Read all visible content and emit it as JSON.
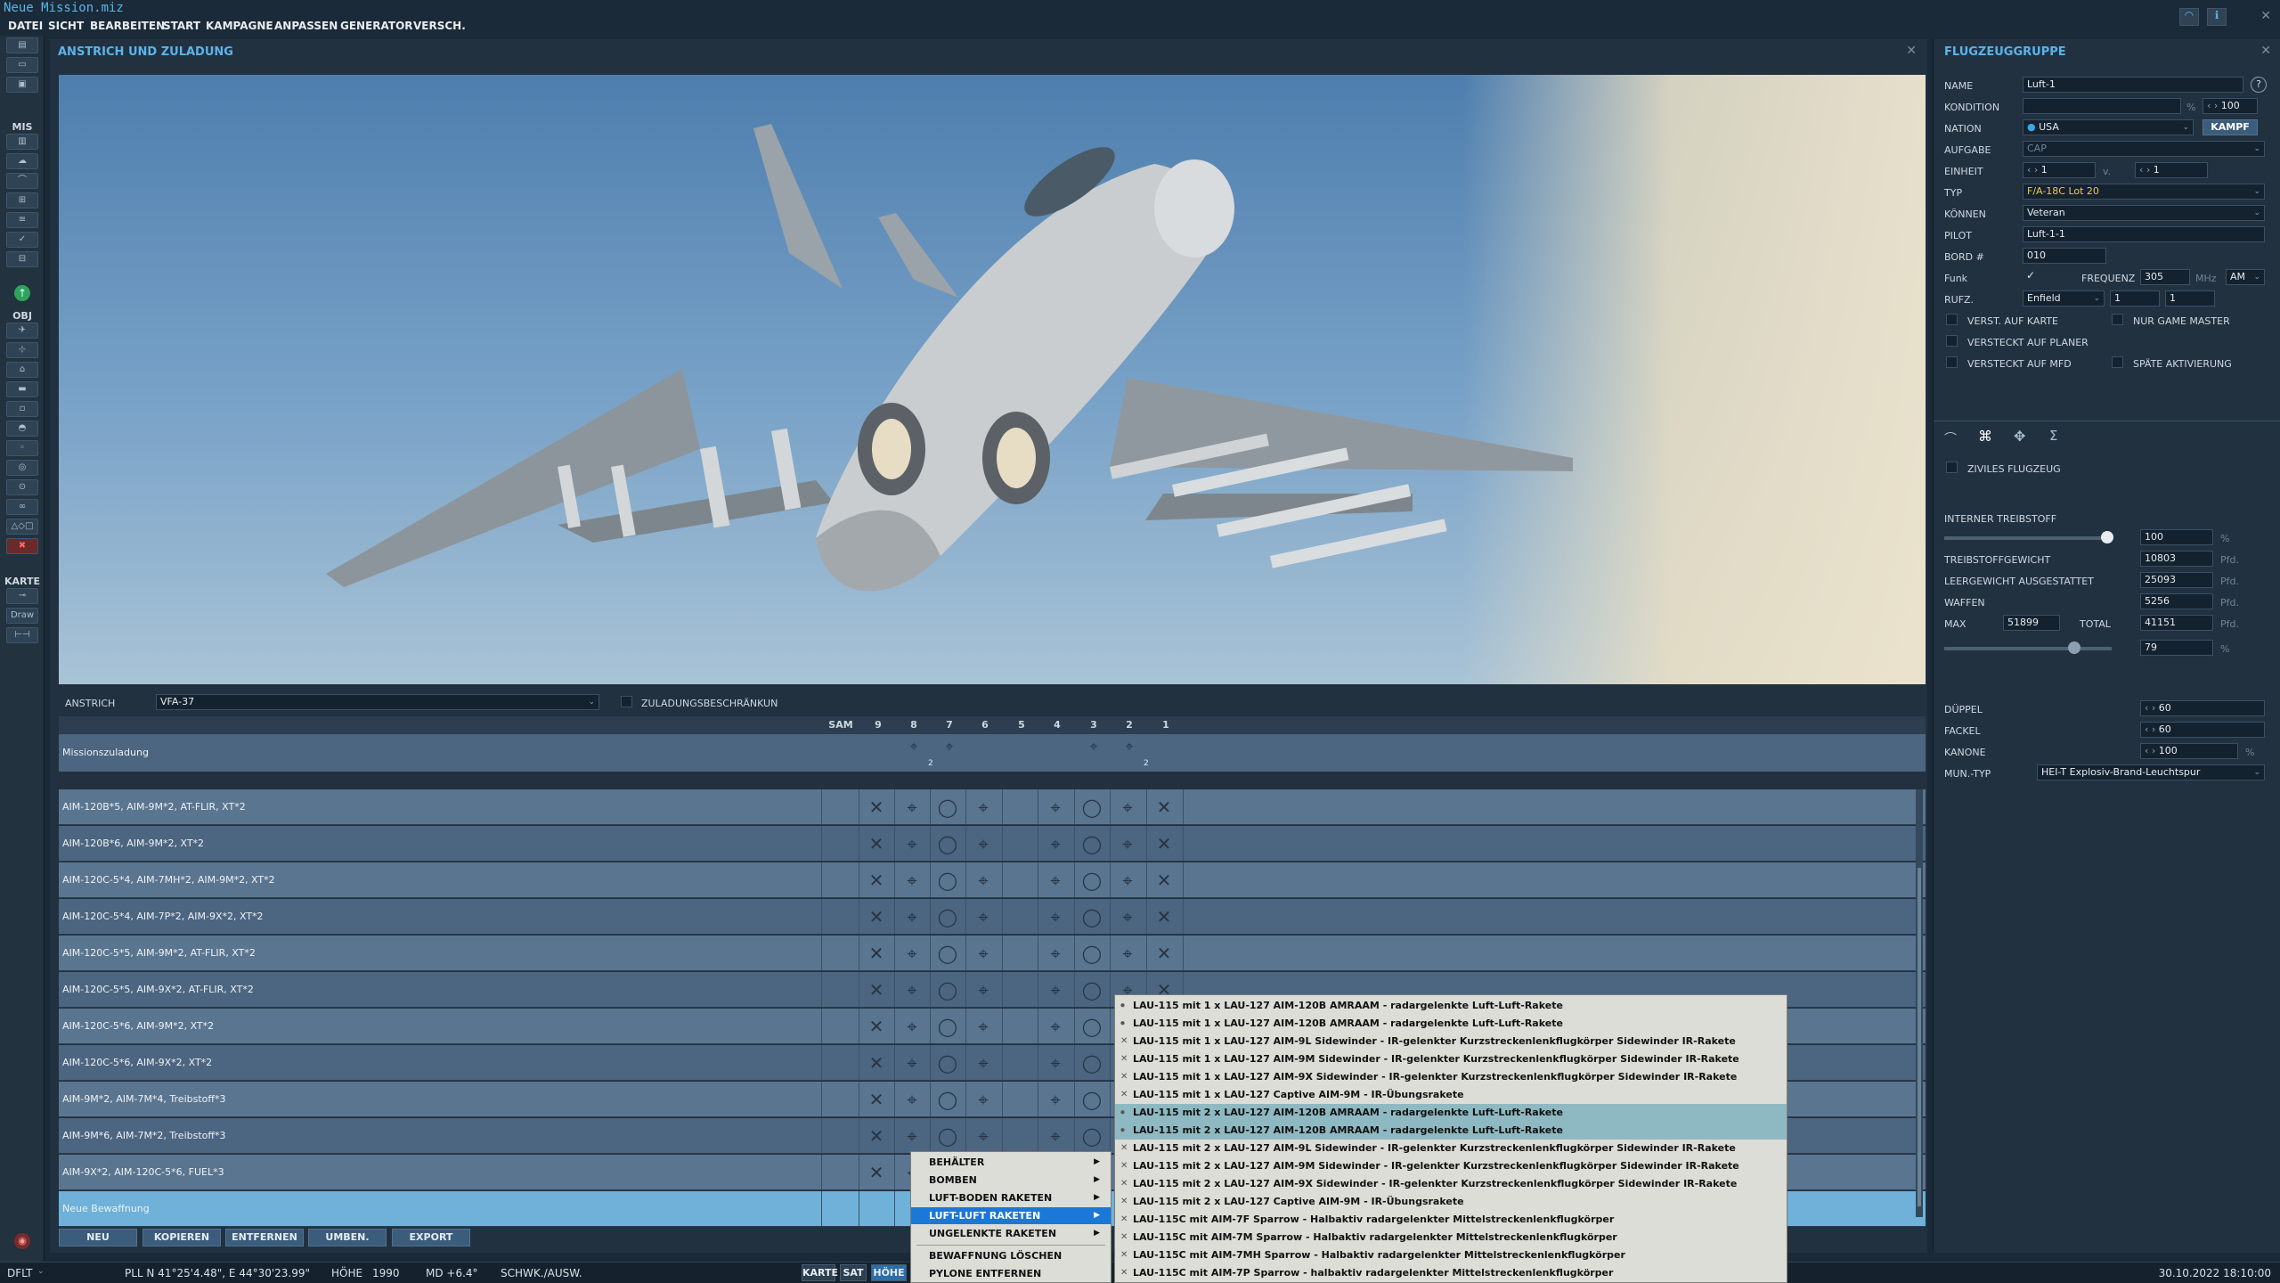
{
  "window": {
    "title": "Neue Mission.miz"
  },
  "menu": [
    "DATEI",
    "SICHT",
    "BEARBEITEN",
    "START",
    "KAMPAGNE",
    "ANPASSEN",
    "GENERATOR",
    "VERSCH."
  ],
  "left_toolbar": {
    "mis_label": "MIS",
    "obj_label": "OBJ",
    "karte_label": "KARTE",
    "draw_label": "Draw"
  },
  "panel": {
    "title": "ANSTRICH UND ZULADUNG",
    "skin_label": "ANSTRICH",
    "skin_value": "VFA-37",
    "restrict_label": "ZULADUNGSBESCHRÄNKUN",
    "columns": [
      "SAM",
      "9",
      "8",
      "7",
      "6",
      "5",
      "4",
      "3",
      "2",
      "1"
    ],
    "mission_row": "Missionszuladung",
    "rows": [
      "AIM-120B*5, AIM-9M*2, AT-FLIR, XT*2",
      "AIM-120B*6, AIM-9M*2, XT*2",
      "AIM-120C-5*4, AIM-7MH*2, AIM-9M*2, XT*2",
      "AIM-120C-5*4, AIM-7P*2, AIM-9X*2, XT*2",
      "AIM-120C-5*5, AIM-9M*2, AT-FLIR, XT*2",
      "AIM-120C-5*5, AIM-9X*2, AT-FLIR, XT*2",
      "AIM-120C-5*6, AIM-9M*2, XT*2",
      "AIM-120C-5*6, AIM-9X*2, XT*2",
      "AIM-9M*2, AIM-7M*4, Treibstoff*3",
      "AIM-9M*6, AIM-7M*2, Treibstoff*3",
      "AIM-9X*2, AIM-120C-5*6, FUEL*3"
    ],
    "new_row": "Neue Bewaffnung",
    "buttons": [
      "NEU",
      "KOPIEREN",
      "ENTFERNEN",
      "UMBEN.",
      "EXPORT"
    ]
  },
  "group": {
    "title": "FLUGZEUGGRUPPE",
    "name_label": "NAME",
    "name": "Luft-1",
    "help": "?",
    "kondition_label": "KONDITION",
    "kondition_unit": "%",
    "kondition": "100",
    "nation_label": "NATION",
    "nation": "USA",
    "kampf": "KAMPF",
    "aufgabe_label": "AUFGABE",
    "aufgabe": "CAP",
    "einheit_label": "EINHEIT",
    "einheit": "1",
    "von": "v.",
    "einheit_of": "1",
    "typ_label": "TYP",
    "typ": "F/A-18C Lot 20",
    "koennen_label": "KÖNNEN",
    "koennen": "Veteran",
    "pilot_label": "PILOT",
    "pilot": "Luft-1-1",
    "bord_label": "BORD #",
    "bord": "010",
    "funk_label": "Funk",
    "freq_label": "FREQUENZ",
    "freq": "305",
    "freq_unit": "MHz",
    "mod": "AM",
    "rufz_label": "RUFZ.",
    "rufz": "Enfield",
    "rufz_a": "1",
    "rufz_b": "1",
    "checks": [
      "VERST. AUF KARTE",
      "NUR GAME MASTER",
      "VERSTECKT AUF PLANER",
      "VERSTECKT AUF MFD",
      "SPÄTE AKTIVIERUNG"
    ],
    "civil": "ZIVILES FLUGZEUG",
    "fuel_label": "INTERNER TREIBSTOFF",
    "fuel_pct": "100",
    "fuel_fraction": 1.0,
    "tw_label": "TREIBSTOFFGEWICHT",
    "tw": "10803",
    "lw_label": "LEERGEWICHT AUSGESTATTET",
    "lw": "25093",
    "waffen_label": "WAFFEN",
    "waffen": "5256",
    "max_label": "MAX",
    "max": "51899",
    "total_label": "TOTAL",
    "total": "41151",
    "load_pct": "79",
    "load_fraction": 0.79,
    "unit_pfd": "Pfd.",
    "unit_pct": "%",
    "chaff_label": "DÜPPEL",
    "chaff": "60",
    "flare_label": "FACKEL",
    "flare": "60",
    "gun_label": "KANONE",
    "gun": "100",
    "ammo_label": "MUN.-TYP",
    "ammo": "HEI-T Explosiv-Brand-Leuchtspur"
  },
  "context_menu": [
    "BEHÄLTER",
    "BOMBEN",
    "LUFT-BODEN RAKETEN",
    "LUFT-LUFT RAKETEN",
    "UNGELENKTE RAKETEN",
    "BEWAFFNUNG LÖSCHEN",
    "PYLONE ENTFERNEN"
  ],
  "submenu": [
    "LAU-115 mit 1 x LAU-127 AIM-120B AMRAAM - radargelenkte Luft-Luft-Rakete",
    "LAU-115 mit 1 x LAU-127 AIM-120B AMRAAM - radargelenkte Luft-Luft-Rakete",
    "LAU-115 mit 1 x LAU-127 AIM-9L Sidewinder - IR-gelenkter Kurzstreckenlenkflugkörper  Sidewinder IR-Rakete",
    "LAU-115 mit 1 x LAU-127 AIM-9M Sidewinder - IR-gelenkter Kurzstreckenlenkflugkörper  Sidewinder IR-Rakete",
    "LAU-115 mit 1 x LAU-127 AIM-9X Sidewinder - IR-gelenkter Kurzstreckenlenkflugkörper  Sidewinder IR-Rakete",
    "LAU-115 mit 1 x LAU-127 Captive AIM-9M - IR-Übungsrakete",
    "LAU-115 mit 2 x LAU-127 AIM-120B AMRAAM - radargelenkte Luft-Luft-Rakete",
    "LAU-115 mit 2 x LAU-127 AIM-120B AMRAAM - radargelenkte Luft-Luft-Rakete",
    "LAU-115 mit 2 x LAU-127 AIM-9L Sidewinder - IR-gelenkter Kurzstreckenlenkflugkörper  Sidewinder IR-Rakete",
    "LAU-115 mit 2 x LAU-127 AIM-9M Sidewinder - IR-gelenkter Kurzstreckenlenkflugkörper  Sidewinder IR-Rakete",
    "LAU-115 mit 2 x LAU-127 AIM-9X Sidewinder - IR-gelenkter Kurzstreckenlenkflugkörper  Sidewinder IR-Rakete",
    "LAU-115 mit 2 x LAU-127 Captive AIM-9M - IR-Übungsrakete",
    "LAU-115C mit AIM-7F Sparrow - Halbaktiv radargelenkter Mittelstreckenlenkflugkörper",
    "LAU-115C mit AIM-7M Sparrow - Halbaktiv radargelenkter Mittelstreckenlenkflugkörper",
    "LAU-115C mit AIM-7MH Sparrow - Halbaktiv radargelenkter Mittelstreckenlenkflugkörper",
    "LAU-115C mit AIM-7P Sparrow - halbaktiv radargelenkter Mittelstreckenlenkflugkörper"
  ],
  "status": {
    "profile": "DFLT",
    "coords": "PLL   N 41°25'4.48\", E 44°30'23.99\"",
    "hoehe_label": "HÖHE",
    "hoehe": "1990",
    "md": "MD  +6.4°",
    "mode": "SCHWK./AUSW.",
    "map_buttons": [
      "KARTE",
      "SAT",
      "HÖHE"
    ],
    "datetime": "30.10.2022 18:10:00"
  },
  "colors": {
    "accent": "#5ab4ea",
    "panel": "#223140",
    "row_a": "#5a7590",
    "row_b": "#4c6580",
    "highlight": "#6fb1d9"
  }
}
